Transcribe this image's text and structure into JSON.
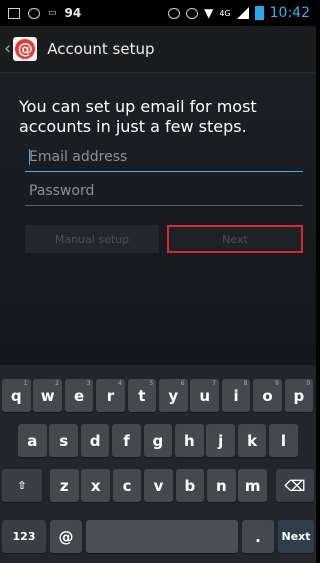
{
  "status_bar": {
    "left_number": "94",
    "network_label": "4G",
    "time": "10:42"
  },
  "action_bar": {
    "back_glyph": "‹",
    "app_icon": "email-app-icon",
    "title": "Account setup"
  },
  "form": {
    "intro_text": "You can set up email for most accounts in just a few steps.",
    "email_placeholder": "Email address",
    "email_value": "",
    "password_placeholder": "Password",
    "password_value": "",
    "manual_setup_label": "Manual setup",
    "next_label": "Next"
  },
  "keyboard": {
    "row1": [
      {
        "key": "q",
        "hint": "1"
      },
      {
        "key": "w",
        "hint": "2"
      },
      {
        "key": "e",
        "hint": "3"
      },
      {
        "key": "r",
        "hint": "4"
      },
      {
        "key": "t",
        "hint": "5"
      },
      {
        "key": "y",
        "hint": "6"
      },
      {
        "key": "u",
        "hint": "7"
      },
      {
        "key": "i",
        "hint": "8"
      },
      {
        "key": "o",
        "hint": "9"
      },
      {
        "key": "p",
        "hint": "0"
      }
    ],
    "row2": [
      "a",
      "s",
      "d",
      "f",
      "g",
      "h",
      "j",
      "k",
      "l"
    ],
    "row3": [
      "z",
      "x",
      "c",
      "v",
      "b",
      "n",
      "m"
    ],
    "shift_glyph": "⇧",
    "backspace_glyph": "⌫",
    "symbols_label": "123",
    "at_label": "@",
    "period_label": ".",
    "next_label": "Next"
  },
  "colors": {
    "accent": "#33b5e5",
    "highlight_border": "#d72a2a"
  }
}
